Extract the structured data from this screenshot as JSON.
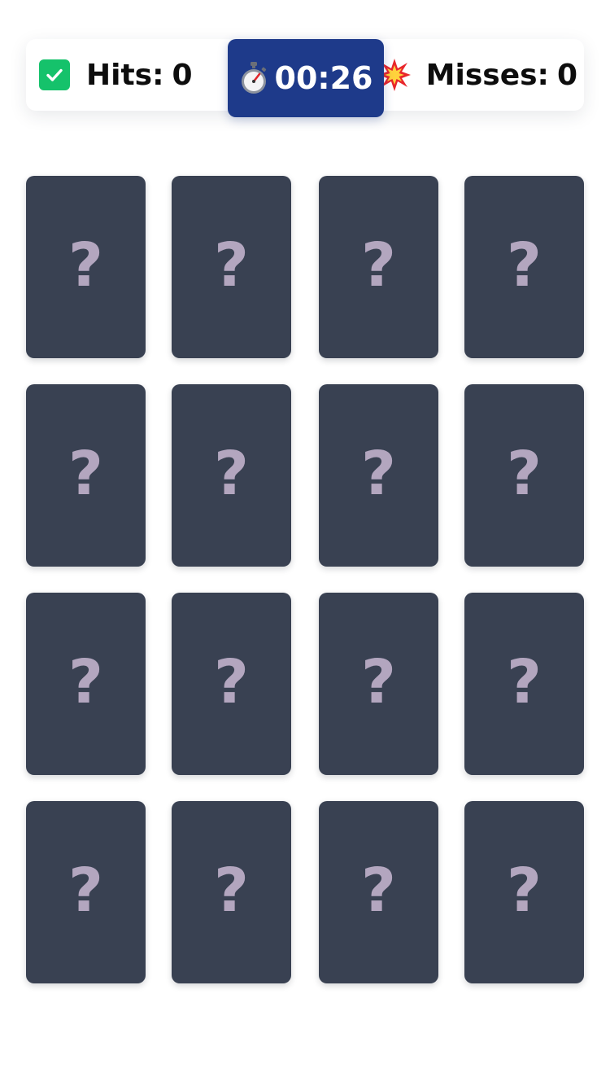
{
  "scoreboard": {
    "hits_label": "Hits:",
    "hits_value": "0",
    "misses_label": "Misses:",
    "misses_value": "0",
    "timer": "00:26",
    "icons": {
      "hits": "check-icon",
      "misses": "explosion-icon",
      "timer": "stopwatch-icon"
    }
  },
  "colors": {
    "timer_bg": "#1e3a8a",
    "card_back": "#394152",
    "question_mark": "#b3a6bf",
    "check_green": "#15c26b"
  },
  "cards": [
    {
      "face": "?"
    },
    {
      "face": "?"
    },
    {
      "face": "?"
    },
    {
      "face": "?"
    },
    {
      "face": "?"
    },
    {
      "face": "?"
    },
    {
      "face": "?"
    },
    {
      "face": "?"
    },
    {
      "face": "?"
    },
    {
      "face": "?"
    },
    {
      "face": "?"
    },
    {
      "face": "?"
    },
    {
      "face": "?"
    },
    {
      "face": "?"
    },
    {
      "face": "?"
    },
    {
      "face": "?"
    }
  ]
}
